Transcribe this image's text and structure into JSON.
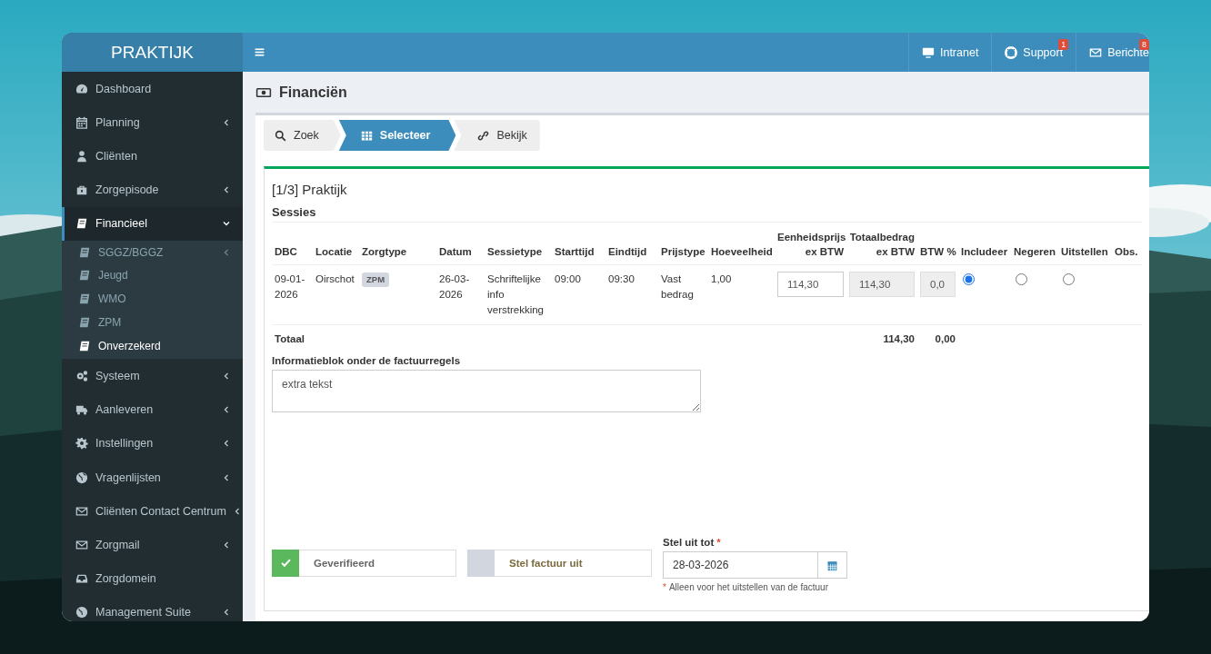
{
  "brand": "PRAKTIJK",
  "sidebar": {
    "items": [
      {
        "label": "Dashboard",
        "kind": "link",
        "selected": false
      },
      {
        "label": "Planning",
        "kind": "submenu",
        "expanded": false,
        "selected": false
      },
      {
        "label": "Cliënten",
        "kind": "link",
        "selected": false
      },
      {
        "label": "Zorgepisode",
        "kind": "submenu",
        "expanded": false,
        "selected": false
      },
      {
        "label": "Financieel",
        "kind": "submenu",
        "expanded": true,
        "selected": true,
        "children": [
          {
            "label": "SGGZ/BGGZ",
            "kind": "submenu",
            "expanded": false,
            "selected": false
          },
          {
            "label": "Jeugd",
            "kind": "link",
            "selected": false
          },
          {
            "label": "WMO",
            "kind": "link",
            "selected": false
          },
          {
            "label": "ZPM",
            "kind": "link",
            "selected": false
          },
          {
            "label": "Onverzekerd",
            "kind": "link",
            "selected": true
          }
        ]
      },
      {
        "label": "Systeem",
        "kind": "submenu",
        "expanded": false,
        "selected": false
      },
      {
        "label": "Aanleveren",
        "kind": "submenu",
        "expanded": false,
        "selected": false
      },
      {
        "label": "Instellingen",
        "kind": "submenu",
        "expanded": false,
        "selected": false
      },
      {
        "label": "Vragenlijsten",
        "kind": "submenu",
        "expanded": false,
        "selected": false
      },
      {
        "label": "Cliënten Contact Centrum",
        "kind": "submenu",
        "expanded": false,
        "selected": false
      },
      {
        "label": "Zorgmail",
        "kind": "submenu",
        "expanded": false,
        "selected": false
      },
      {
        "label": "Zorgdomein",
        "kind": "link",
        "selected": false
      },
      {
        "label": "Management Suite",
        "kind": "submenu",
        "expanded": false,
        "selected": false
      }
    ]
  },
  "top_nav": {
    "items": [
      {
        "label": "Intranet"
      },
      {
        "label": "Support",
        "badge": "1"
      },
      {
        "label": "Berichte",
        "badge": "8"
      }
    ]
  },
  "page_title": "Financiën",
  "wizard": {
    "steps": [
      {
        "label": "Zoek",
        "selected": false
      },
      {
        "label": "Selecteer",
        "selected": true
      },
      {
        "label": "Bekijk",
        "selected": false
      }
    ]
  },
  "panel": {
    "title": "[1/3] Praktijk",
    "section": "Sessies"
  },
  "table": {
    "columns": [
      "DBC",
      "Locatie",
      "Zorgtype",
      "Datum",
      "Sessietype",
      "Starttijd",
      "Eindtijd",
      "Prijstype",
      "Hoeveelheid",
      "Eenheidsprijs ex BTW",
      "Totaalbedrag ex BTW",
      "BTW %",
      "Includeer",
      "Negeren",
      "Uitstellen",
      "Obs."
    ],
    "rows": [
      {
        "dbc": "09-01-2026",
        "locatie": "Oirschot",
        "zorgtype": "ZPM",
        "datum": "26-03-2026",
        "sessietype": "Schriftelijke info verstrekking",
        "starttijd": "09:00",
        "eindtijd": "09:30",
        "prijstype": "Vast bedrag",
        "hoeveelheid": "1,00",
        "eenheidsprijs": "114,30",
        "totaalbedrag": "114,30",
        "btw": "0,0",
        "includeer": true,
        "negeren": false,
        "uitstellen": false
      }
    ],
    "total": {
      "label": "Totaal",
      "totaalbedrag": "114,30",
      "btw": "0,00"
    }
  },
  "form": {
    "info_label": "Informatieblok onder de factuurregels",
    "info_value": "extra tekst",
    "toggles": [
      {
        "label": "Geverifieerd",
        "checked": true
      },
      {
        "label": "Stel factuur uit",
        "checked": false
      }
    ],
    "date": {
      "label": "Stel uit tot",
      "required_mark": "*",
      "value": "28-03-2026",
      "note_mark": "*",
      "note": "Alleen voor het uitstellen van de factuur"
    }
  }
}
